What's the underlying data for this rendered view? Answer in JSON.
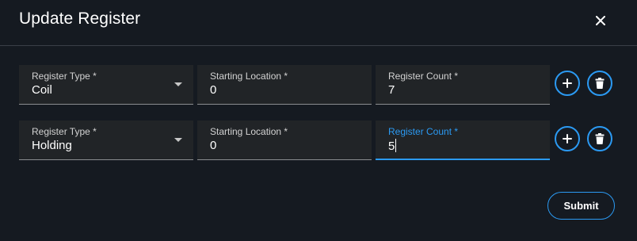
{
  "dialog": {
    "title": "Update Register",
    "close_icon": "close-icon"
  },
  "rows": [
    {
      "register_type": {
        "label": "Register Type *",
        "value": "Coil",
        "icon": "chevron-down-icon"
      },
      "starting_location": {
        "label": "Starting Location *",
        "value": "0"
      },
      "register_count": {
        "label": "Register Count *",
        "value": "7"
      },
      "add_icon": "plus-icon",
      "delete_icon": "trash-icon"
    },
    {
      "register_type": {
        "label": "Register Type *",
        "value": "Holding",
        "icon": "chevron-down-icon"
      },
      "starting_location": {
        "label": "Starting Location *",
        "value": "0"
      },
      "register_count": {
        "label": "Register Count *",
        "value": "5",
        "focused": true
      },
      "add_icon": "plus-icon",
      "delete_icon": "trash-icon"
    }
  ],
  "footer": {
    "submit_label": "Submit"
  },
  "colors": {
    "background": "#151a21",
    "field_background": "#212427",
    "accent": "#2b9af3",
    "text": "#ffffff"
  }
}
